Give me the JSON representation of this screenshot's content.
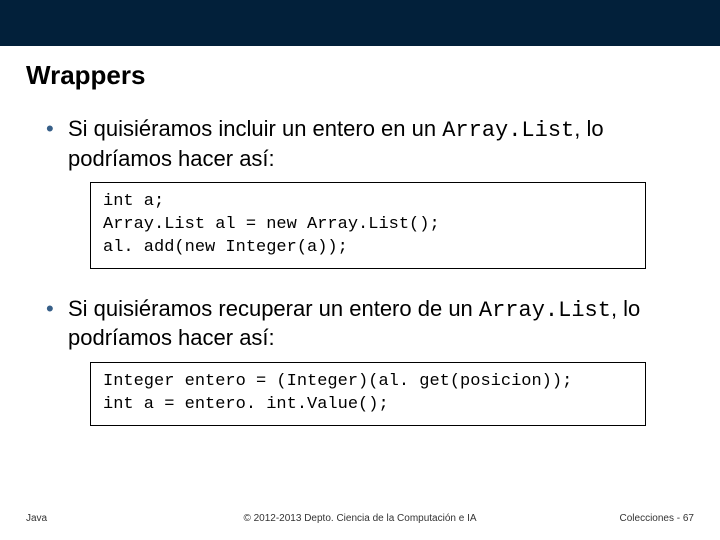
{
  "title": "Wrappers",
  "bullet1": {
    "pre": "Si quisiéramos incluir un entero en un ",
    "code": "Array.List",
    "post": ", lo podríamos hacer así:"
  },
  "code1": "int a;\nArray.List al = new Array.List();\nal. add(new Integer(a));",
  "bullet2": {
    "pre": "Si quisiéramos recuperar un entero de un ",
    "code": "Array.List",
    "post": ", lo podríamos hacer así:"
  },
  "code2": "Integer entero = (Integer)(al. get(posicion));\nint a = entero. int.Value();",
  "footer": {
    "left": "Java",
    "center": "© 2012-2013 Depto. Ciencia de la Computación e IA",
    "right": "Colecciones - 67"
  }
}
